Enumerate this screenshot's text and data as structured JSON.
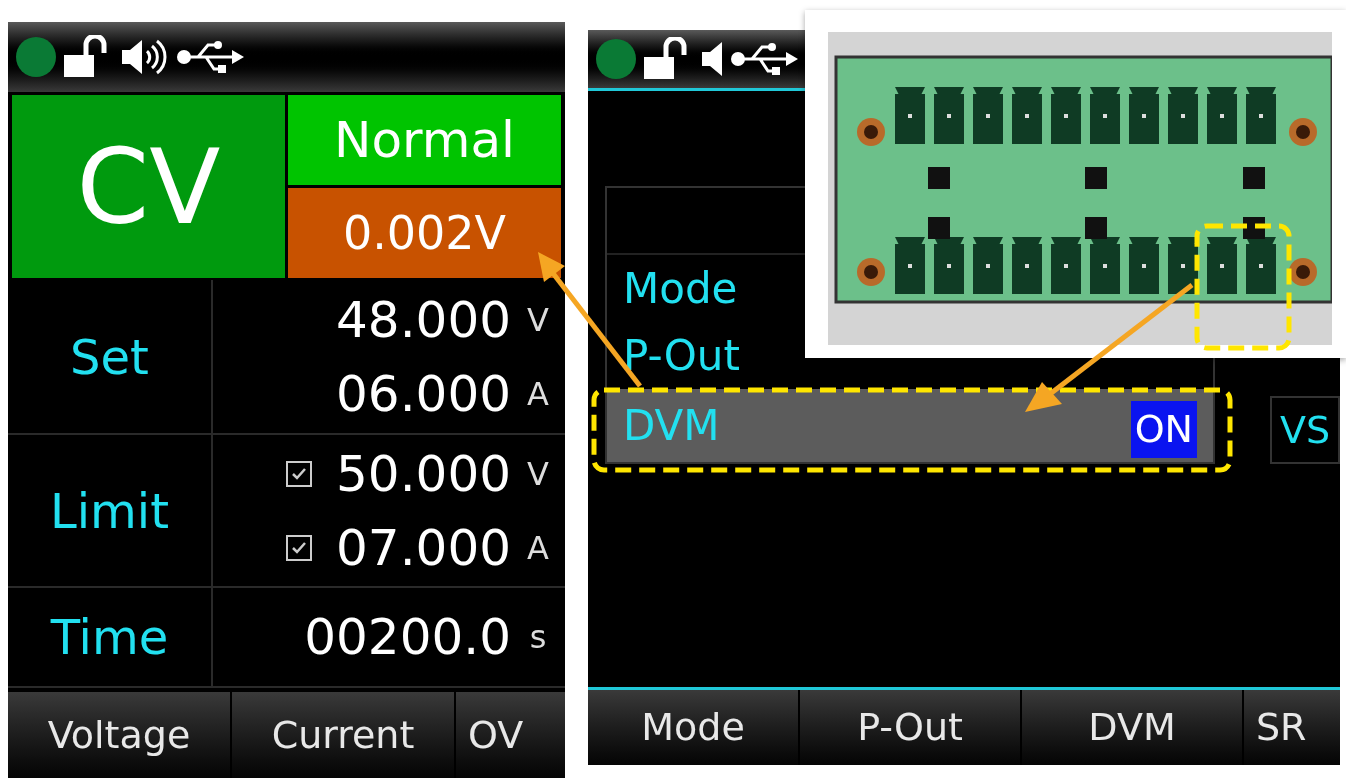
{
  "left_screen": {
    "status": {
      "locked": false,
      "sound_on": true
    },
    "mode": "CV",
    "state": "Normal",
    "reading": "0.002V",
    "rows": [
      {
        "label": "Set",
        "values": [
          {
            "value": "48.000",
            "unit": "V"
          },
          {
            "value": "06.000",
            "unit": "A"
          }
        ]
      },
      {
        "label": "Limit",
        "values": [
          {
            "checked": true,
            "value": "50.000",
            "unit": "V"
          },
          {
            "checked": true,
            "value": "07.000",
            "unit": "A"
          }
        ]
      },
      {
        "label": "Time",
        "values": [
          {
            "value": "00200.0",
            "unit": "s"
          }
        ]
      }
    ],
    "softkeys": [
      "Voltage",
      "Current",
      "OV"
    ]
  },
  "right_screen": {
    "status": {
      "locked": false,
      "sound_on": false
    },
    "menu": [
      {
        "label": "Mode",
        "selected": false
      },
      {
        "label": "P-Out",
        "selected": false
      },
      {
        "label": "DVM",
        "value": "ON",
        "selected": true
      }
    ],
    "side_column": [
      "VS"
    ],
    "softkeys": [
      "Mode",
      "P-Out",
      "DVM",
      "SR"
    ]
  }
}
